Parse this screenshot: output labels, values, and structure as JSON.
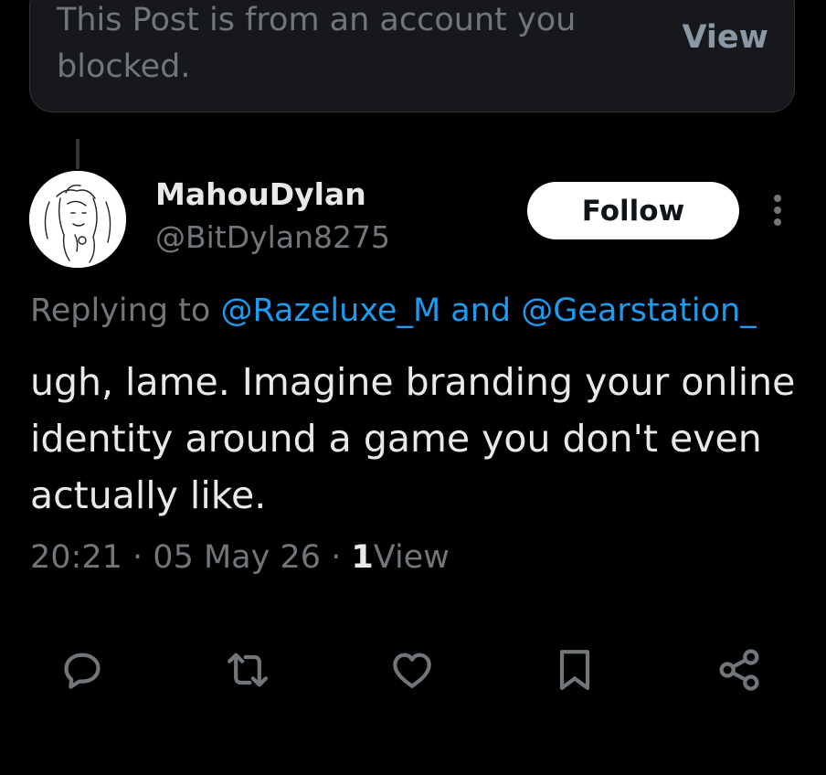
{
  "blocked_notice": {
    "text": "This Post is from an account you blocked.",
    "view_label": "View"
  },
  "author": {
    "display_name": "MahouDylan",
    "handle": "@BitDylan8275",
    "follow_label": "Follow"
  },
  "reply_context": {
    "prefix": "Replying to",
    "mention_1": "@Razeluxe_M",
    "joiner": "and",
    "mention_2": "@Gearstation_"
  },
  "post": {
    "text": "ugh, lame. Imagine branding your online identity around a game you don't even actually like.",
    "time": "20:21",
    "sep": "·",
    "date": "05 May 26",
    "views_count": "1",
    "views_label": "View"
  },
  "actions": [
    {
      "icon": "reply-icon"
    },
    {
      "icon": "repost-icon"
    },
    {
      "icon": "like-icon"
    },
    {
      "icon": "bookmark-icon"
    },
    {
      "icon": "share-icon"
    }
  ],
  "colors": {
    "background": "#000000",
    "text": "#e7e9ea",
    "muted": "#71767b",
    "link": "#1d9bf0",
    "card": "#16181c"
  }
}
